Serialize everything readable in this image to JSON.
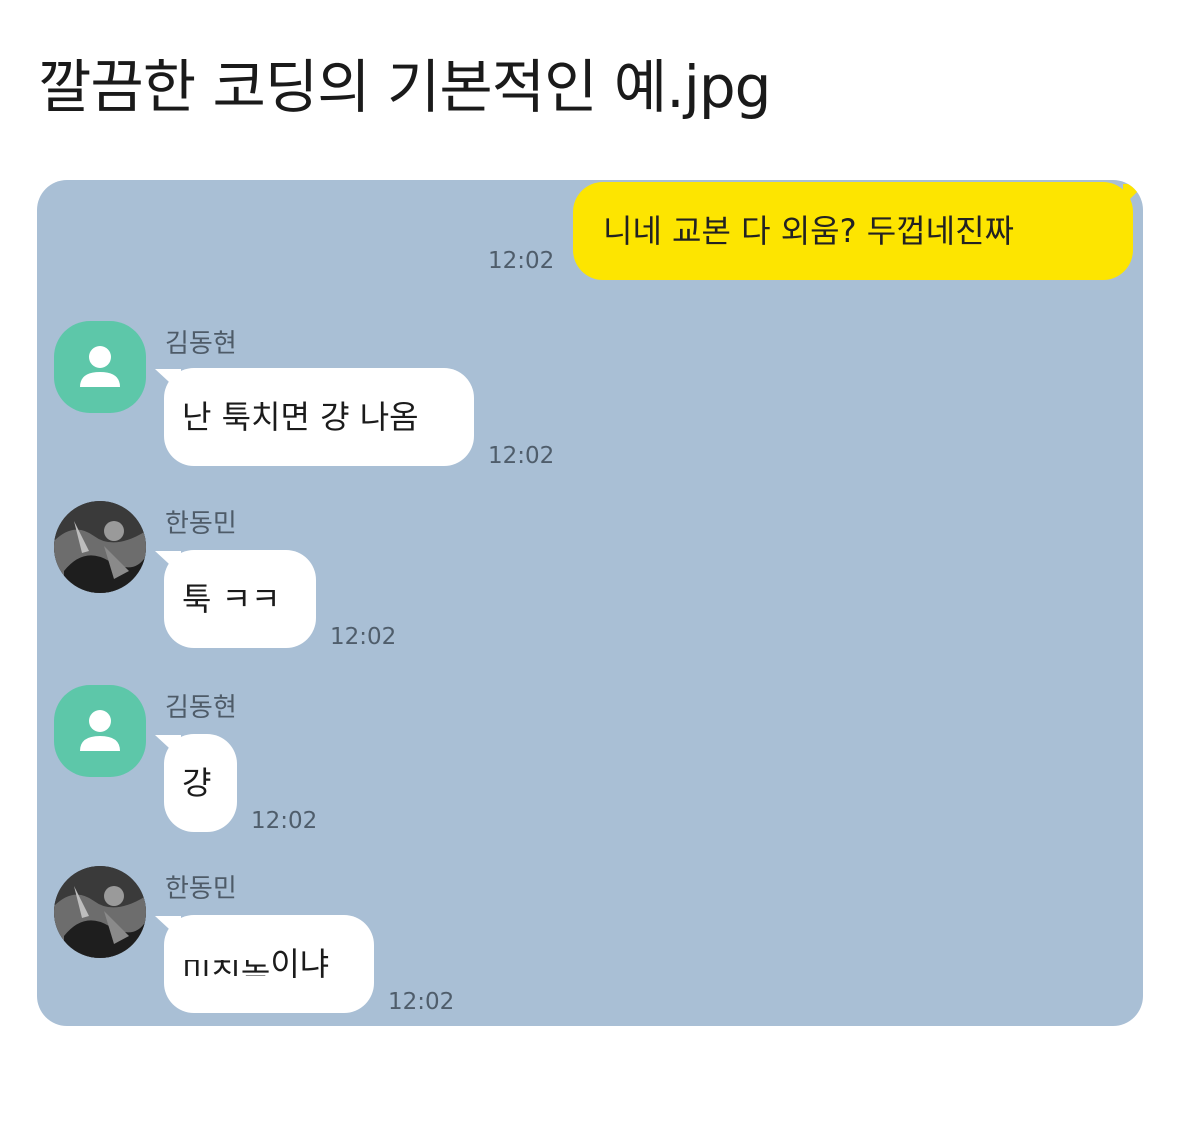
{
  "post": {
    "title": "깔끔한 코딩의 기본적인 예.jpg"
  },
  "colors": {
    "panel_bg": "#a9bfd5",
    "mine_bubble": "#fde500",
    "other_bubble": "#ffffff",
    "default_avatar": "#5dc7a9"
  },
  "messages": [
    {
      "sender": "",
      "mine": true,
      "text": "니네 교본 다 외움? 두껍네진짜",
      "time": "12:02"
    },
    {
      "sender": "김동현",
      "mine": false,
      "avatar": "default-person-icon",
      "text": "난 툭치면 걍 나옴",
      "time": "12:02"
    },
    {
      "sender": "한동민",
      "mine": false,
      "avatar": "photo-avatar",
      "text": "툭 ㅋㅋ",
      "time": "12:02"
    },
    {
      "sender": "김동현",
      "mine": false,
      "avatar": "default-person-icon",
      "text": "걍",
      "time": "12:02"
    },
    {
      "sender": "한동민",
      "mine": false,
      "avatar": "photo-avatar",
      "text_cut": "미친놈",
      "text": "이냐",
      "time": "12:02"
    }
  ]
}
